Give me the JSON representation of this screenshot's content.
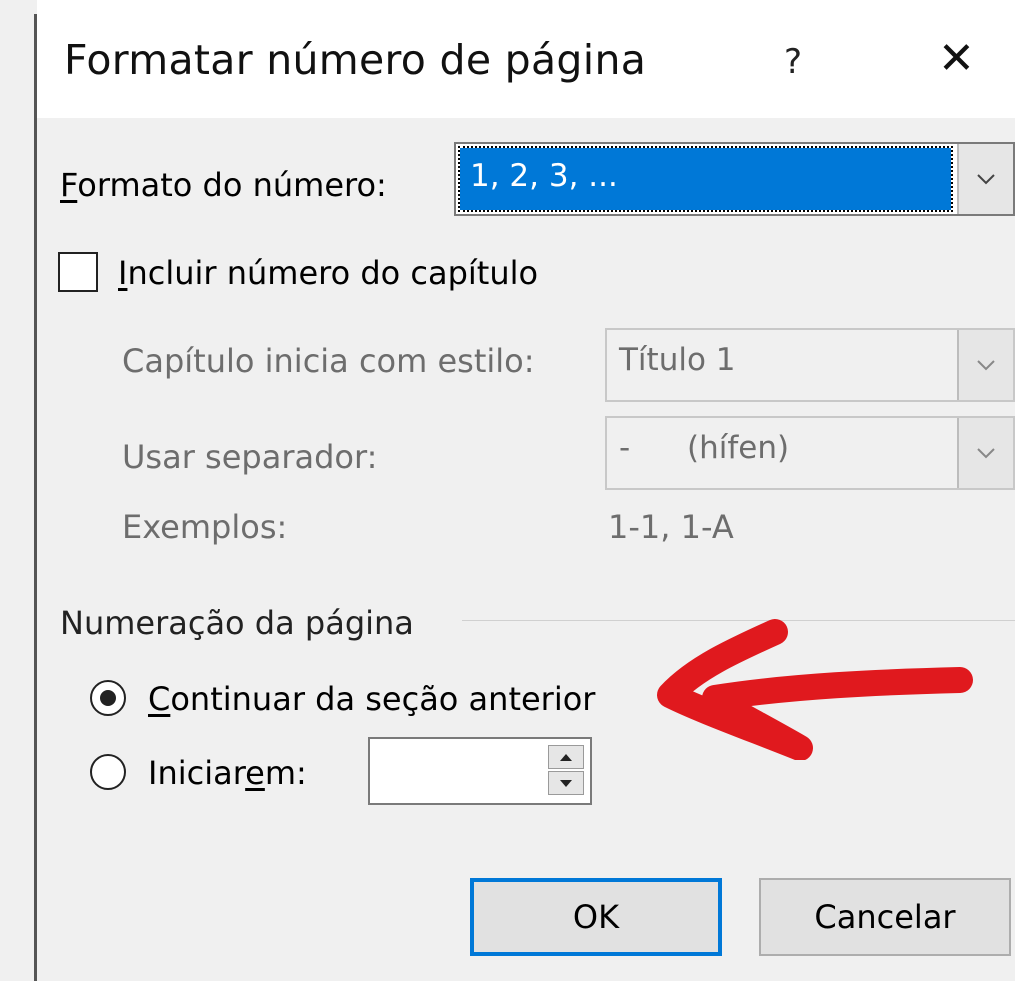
{
  "dialog": {
    "title": "Formatar número de página",
    "help_label": "?",
    "close_label": "✕"
  },
  "number_format": {
    "label_first": "F",
    "label_rest": "ormato do número:",
    "value": "1, 2, 3, ..."
  },
  "include_chapter": {
    "label_first": "I",
    "label_rest": "ncluir número do capítulo",
    "checked": false
  },
  "chapter_style": {
    "label": "Capítulo inicia com estilo:",
    "value": "Título 1"
  },
  "separator": {
    "label": "Usar separador:",
    "value_dash": "-",
    "value_name": "(hífen)"
  },
  "examples": {
    "label": "Exemplos:",
    "value": "1-1, 1-A"
  },
  "page_numbering": {
    "group_label": "Numeração da página",
    "continue_first": "C",
    "continue_rest": "ontinuar da seção anterior",
    "continue_selected": true,
    "start_at_pre": "Iniciar",
    "start_at_ul": "e",
    "start_at_post": "m:",
    "start_at_selected": false,
    "start_at_value": ""
  },
  "buttons": {
    "ok": "OK",
    "cancel": "Cancelar"
  },
  "annotation": {
    "arrow_color": "#e0191e"
  }
}
